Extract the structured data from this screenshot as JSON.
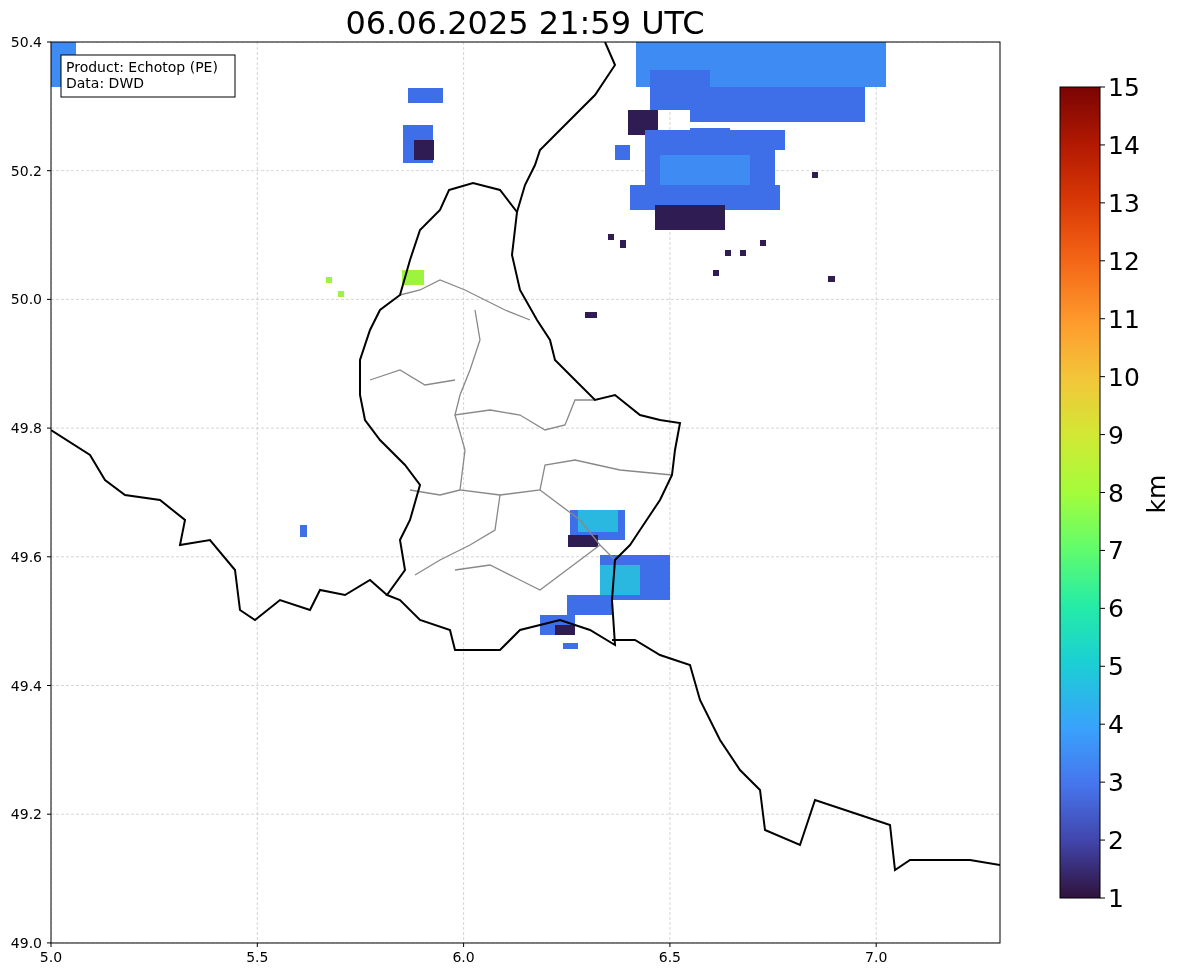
{
  "title": "06.06.2025 21:59 UTC",
  "info_box": {
    "lines": [
      "Product: Echotop (PE)",
      "Data: DWD"
    ]
  },
  "x_ticks": [
    "5.0",
    "5.5",
    "6.0",
    "6.5",
    "7.0"
  ],
  "y_ticks": [
    "50.4",
    "50.2",
    "50.0",
    "49.8",
    "49.6",
    "49.4",
    "49.2",
    "49.0"
  ],
  "colorbar": {
    "label": "km",
    "ticks": [
      "15",
      "14",
      "13",
      "12",
      "11",
      "10",
      "9",
      "8",
      "7",
      "6",
      "5",
      "4",
      "3",
      "2",
      "1"
    ]
  }
}
